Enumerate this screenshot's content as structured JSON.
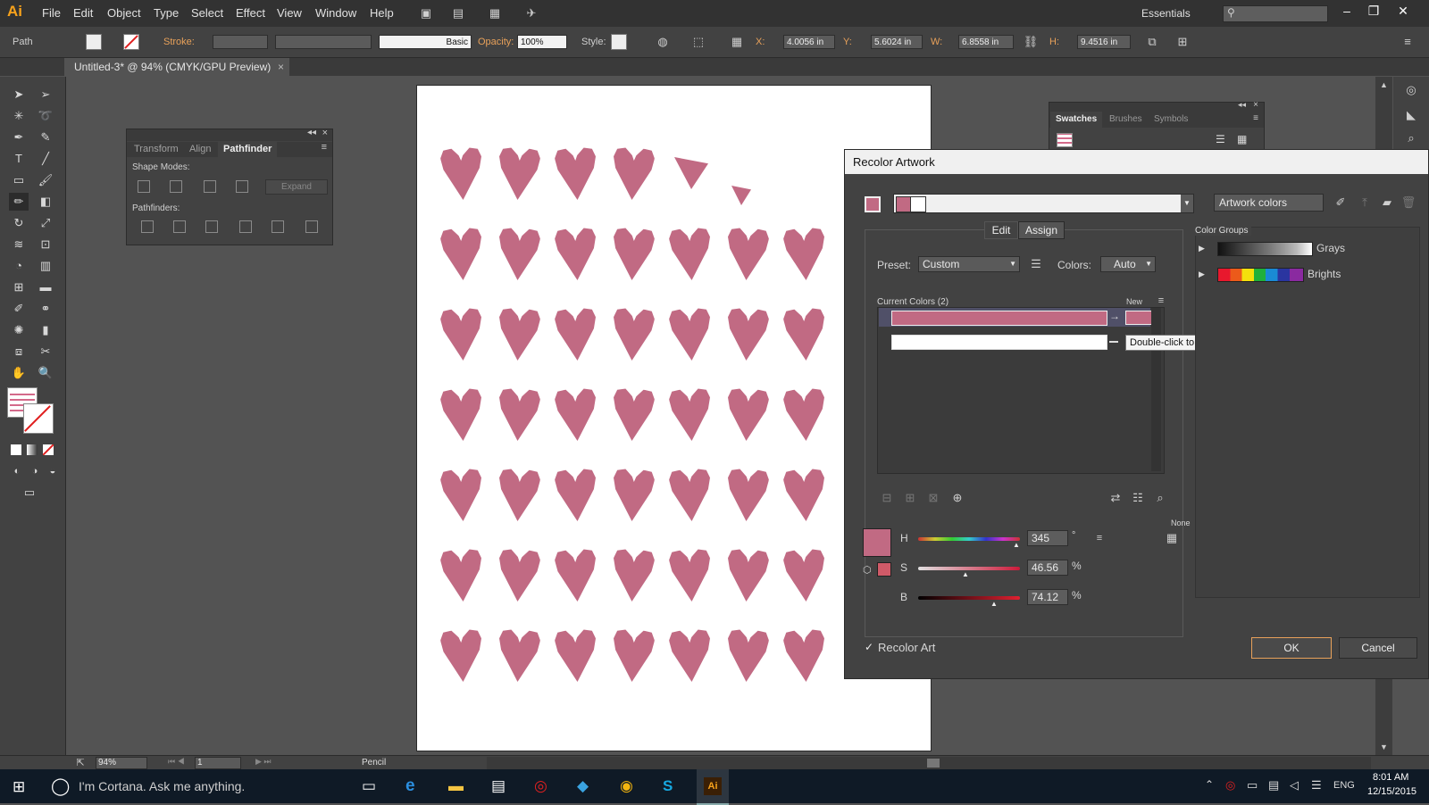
{
  "app": {
    "logo": "Ai",
    "workspace": "Essentials"
  },
  "menu": [
    "File",
    "Edit",
    "Object",
    "Type",
    "Select",
    "Effect",
    "View",
    "Window",
    "Help"
  ],
  "control_bar": {
    "selection": "Path",
    "stroke_label": "Stroke:",
    "brush": "Basic",
    "opacity_label": "Opacity:",
    "opacity_value": "100%",
    "style_label": "Style:",
    "x_label": "X:",
    "x_value": "4.0056 in",
    "y_label": "Y:",
    "y_value": "5.6024 in",
    "w_label": "W:",
    "w_value": "6.8558 in",
    "h_label": "H:",
    "h_value": "9.4516 in"
  },
  "document_tab": "Untitled-3* @ 94% (CMYK/GPU Preview)",
  "pathfinder_panel": {
    "tabs": [
      "Transform",
      "Align",
      "Pathfinder"
    ],
    "shape_modes": "Shape Modes:",
    "expand": "Expand",
    "pathfinders": "Pathfinders:"
  },
  "swatches_panel": {
    "tabs": [
      "Swatches",
      "Brushes",
      "Symbols"
    ]
  },
  "recolor": {
    "title": "Recolor Artwork",
    "artwork_colors": "Artwork colors",
    "tabs": {
      "edit": "Edit",
      "assign": "Assign"
    },
    "preset_label": "Preset:",
    "preset_value": "Custom",
    "colors_label": "Colors:",
    "colors_value": "Auto",
    "current_colors": "Current Colors (2)",
    "new_label": "New",
    "tooltip": "Double-click to edit color. Drag to swap.",
    "none_label": "None",
    "h_label": "H",
    "h_value": "345",
    "h_unit": "°",
    "s_label": "S",
    "s_value": "46.56",
    "s_unit": "%",
    "b_label": "B",
    "b_value": "74.12",
    "b_unit": "%",
    "recolor_art": "Recolor Art",
    "ok": "OK",
    "cancel": "Cancel",
    "color_groups_label": "Color Groups",
    "groups": [
      "Grays",
      "Brights"
    ]
  },
  "status_bar": {
    "zoom": "94%",
    "page": "1",
    "tool": "Pencil"
  },
  "taskbar": {
    "search": "I'm Cortana. Ask me anything.",
    "lang": "ENG",
    "time": "8:01 AM",
    "date": "12/15/2015"
  },
  "colors": {
    "heart": "#c16a83",
    "accent": "#f7a21b"
  }
}
